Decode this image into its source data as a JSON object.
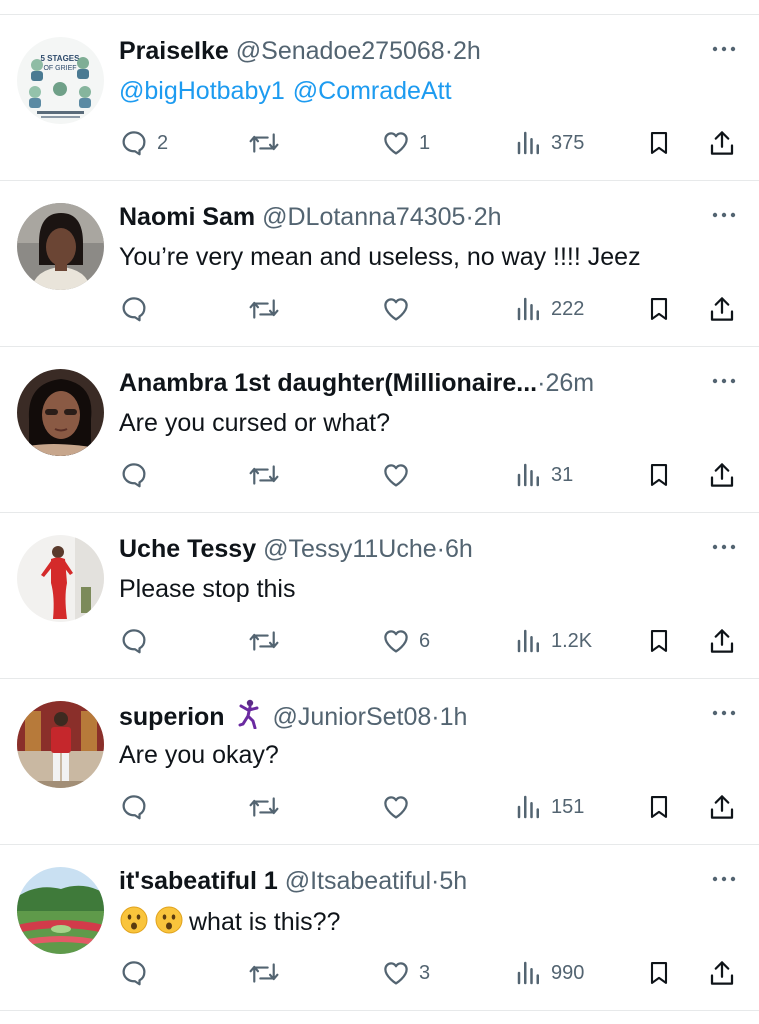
{
  "tweets": [
    {
      "avatar": "avatar-stages-of-grief-infographic",
      "name": "PraiseIke",
      "handle": "@Senadoe275068",
      "dot": "·",
      "time": "2h",
      "mentions": [
        "@bigHotbaby1",
        "@ComradeAtt"
      ],
      "text": "",
      "replies": "2",
      "retweets": "",
      "likes": "1",
      "views": "375"
    },
    {
      "avatar": "avatar-woman-portrait",
      "name": "Naomi Sam",
      "handle": "@DLotanna74305",
      "dot": "·",
      "time": "2h",
      "mentions": [],
      "text": "You’re very mean and useless, no way !!!! Jeez",
      "replies": "",
      "retweets": "",
      "likes": "",
      "views": "222"
    },
    {
      "avatar": "avatar-woman-selfie",
      "name": "Anambra 1st daughter(Millionaire...",
      "handle": "",
      "dot": "·",
      "time": "26m",
      "mentions": [],
      "text": "Are you cursed or what?",
      "replies": "",
      "retweets": "",
      "likes": "",
      "views": "31"
    },
    {
      "avatar": "avatar-woman-red-dress",
      "name": "Uche Tessy",
      "handle": "@Tessy11Uche",
      "dot": "·",
      "time": "6h",
      "mentions": [],
      "text": "Please stop this",
      "replies": "",
      "retweets": "",
      "likes": "6",
      "views": "1.2K"
    },
    {
      "avatar": "avatar-man-red-shirt",
      "name": "superion",
      "name_emoji": "dancing-figure-emoji",
      "handle": "@JuniorSet08",
      "dot": "·",
      "time": "1h",
      "mentions": [],
      "text": "Are you okay?",
      "replies": "",
      "retweets": "",
      "likes": "",
      "views": "151"
    },
    {
      "avatar": "avatar-garden-landscape",
      "name": "it'sabeatiful 1",
      "handle": "@Itsabeatiful",
      "dot": "·",
      "time": "5h",
      "mentions": [],
      "text_emoji": "hushed-face-emoji",
      "text": "what is this??",
      "replies": "",
      "retweets": "",
      "likes": "3",
      "views": "990"
    }
  ],
  "icons": {
    "reply": "reply-icon",
    "retweet": "retweet-icon",
    "like": "heart-icon",
    "views": "views-icon",
    "bookmark": "bookmark-icon",
    "share": "share-icon",
    "more": "more-icon"
  },
  "colors": {
    "text": "#0f1419",
    "secondary": "#536471",
    "link": "#1d9bf0",
    "divider": "#e7e9ea"
  }
}
